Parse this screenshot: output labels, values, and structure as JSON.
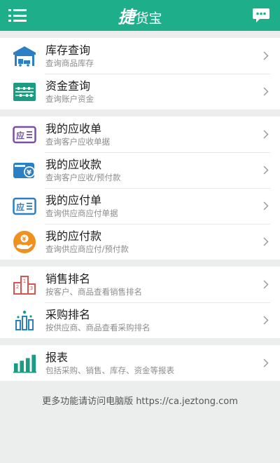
{
  "header": {
    "title_main": "捷",
    "title_sub": "货宝"
  },
  "groups": [
    {
      "items": [
        {
          "title": "库存查询",
          "subtitle": "查询商品库存",
          "icon": "warehouse-icon"
        },
        {
          "title": "资金查询",
          "subtitle": "查询账户资金",
          "icon": "abacus-icon"
        }
      ]
    },
    {
      "items": [
        {
          "title": "我的应收单",
          "subtitle": "查询客户应收单据",
          "icon": "receivable-bill-icon"
        },
        {
          "title": "我的应收款",
          "subtitle": "查询客户应收/预付款",
          "icon": "wallet-yuan-icon"
        },
        {
          "title": "我的应付单",
          "subtitle": "查询供应商应付单据",
          "icon": "payable-bill-icon"
        },
        {
          "title": "我的应付款",
          "subtitle": "查询供应商应付/预付款",
          "icon": "hand-coin-icon"
        }
      ]
    },
    {
      "items": [
        {
          "title": "销售排名",
          "subtitle": "按客户、商品查看销售排名",
          "icon": "podium-icon"
        },
        {
          "title": "采购排名",
          "subtitle": "按供应商、商品查看采购排名",
          "icon": "ranking-bars-icon"
        }
      ]
    },
    {
      "items": [
        {
          "title": "报表",
          "subtitle": "包括采购、销售、库存、资金等报表",
          "icon": "bar-chart-icon"
        }
      ]
    }
  ],
  "footer": {
    "note": "更多功能请访问电脑版 https://ca.jeztong.com"
  },
  "colors": {
    "header": "#1eae8a",
    "icon_blue": "#2b7fc4",
    "icon_teal": "#1a9b82",
    "icon_purple": "#7b4fa6",
    "icon_orange": "#f0901e",
    "icon_red": "#d9534f"
  }
}
